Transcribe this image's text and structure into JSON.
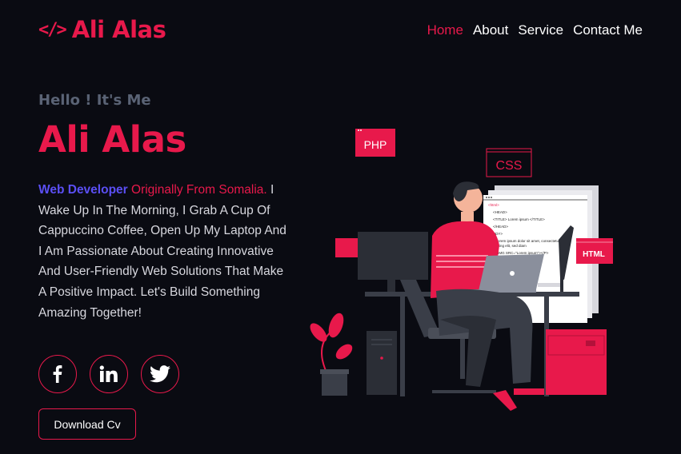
{
  "header": {
    "logo_icon": "</>",
    "logo_text": "Ali Alas",
    "nav": [
      {
        "label": "Home",
        "active": true
      },
      {
        "label": "About",
        "active": false
      },
      {
        "label": "Service",
        "active": false
      },
      {
        "label": "Contact Me",
        "active": false
      }
    ]
  },
  "hero": {
    "greeting": "Hello ! It's Me",
    "name": "Ali Alas",
    "role": "Web Developer",
    "origin": "Originally From Somalia.",
    "bio": "I Wake Up In The Morning, I Grab A Cup Of Cappuccino Coffee, Open Up My Laptop And I Am Passionate About Creating Innovative And User-Friendly Web Solutions That Make A Positive Impact. Let's Build Something Amazing Together!",
    "download_label": "Download Cv"
  },
  "socials": [
    {
      "icon": "facebook-icon"
    },
    {
      "icon": "linkedin-icon"
    },
    {
      "icon": "twitter-icon"
    }
  ],
  "illustration": {
    "tag_php": "PHP",
    "tag_css": "CSS",
    "tag_html": "HTML",
    "code_lines": [
      "<html>",
      "<HEAD>",
      "<TITLE> Lorem ipsum </TITLE>",
      "</HEAD>",
      "<BODY>",
      "<P> Lorem ipsum dolor sit amet, consectetur",
      "adipiscing elit, sed diam",
      "<P> <IMG SRC=\"Lorem ipsum\"></P>"
    ]
  },
  "colors": {
    "accent": "#e8194b",
    "role": "#5b4ff5",
    "background": "#0a0b12"
  }
}
